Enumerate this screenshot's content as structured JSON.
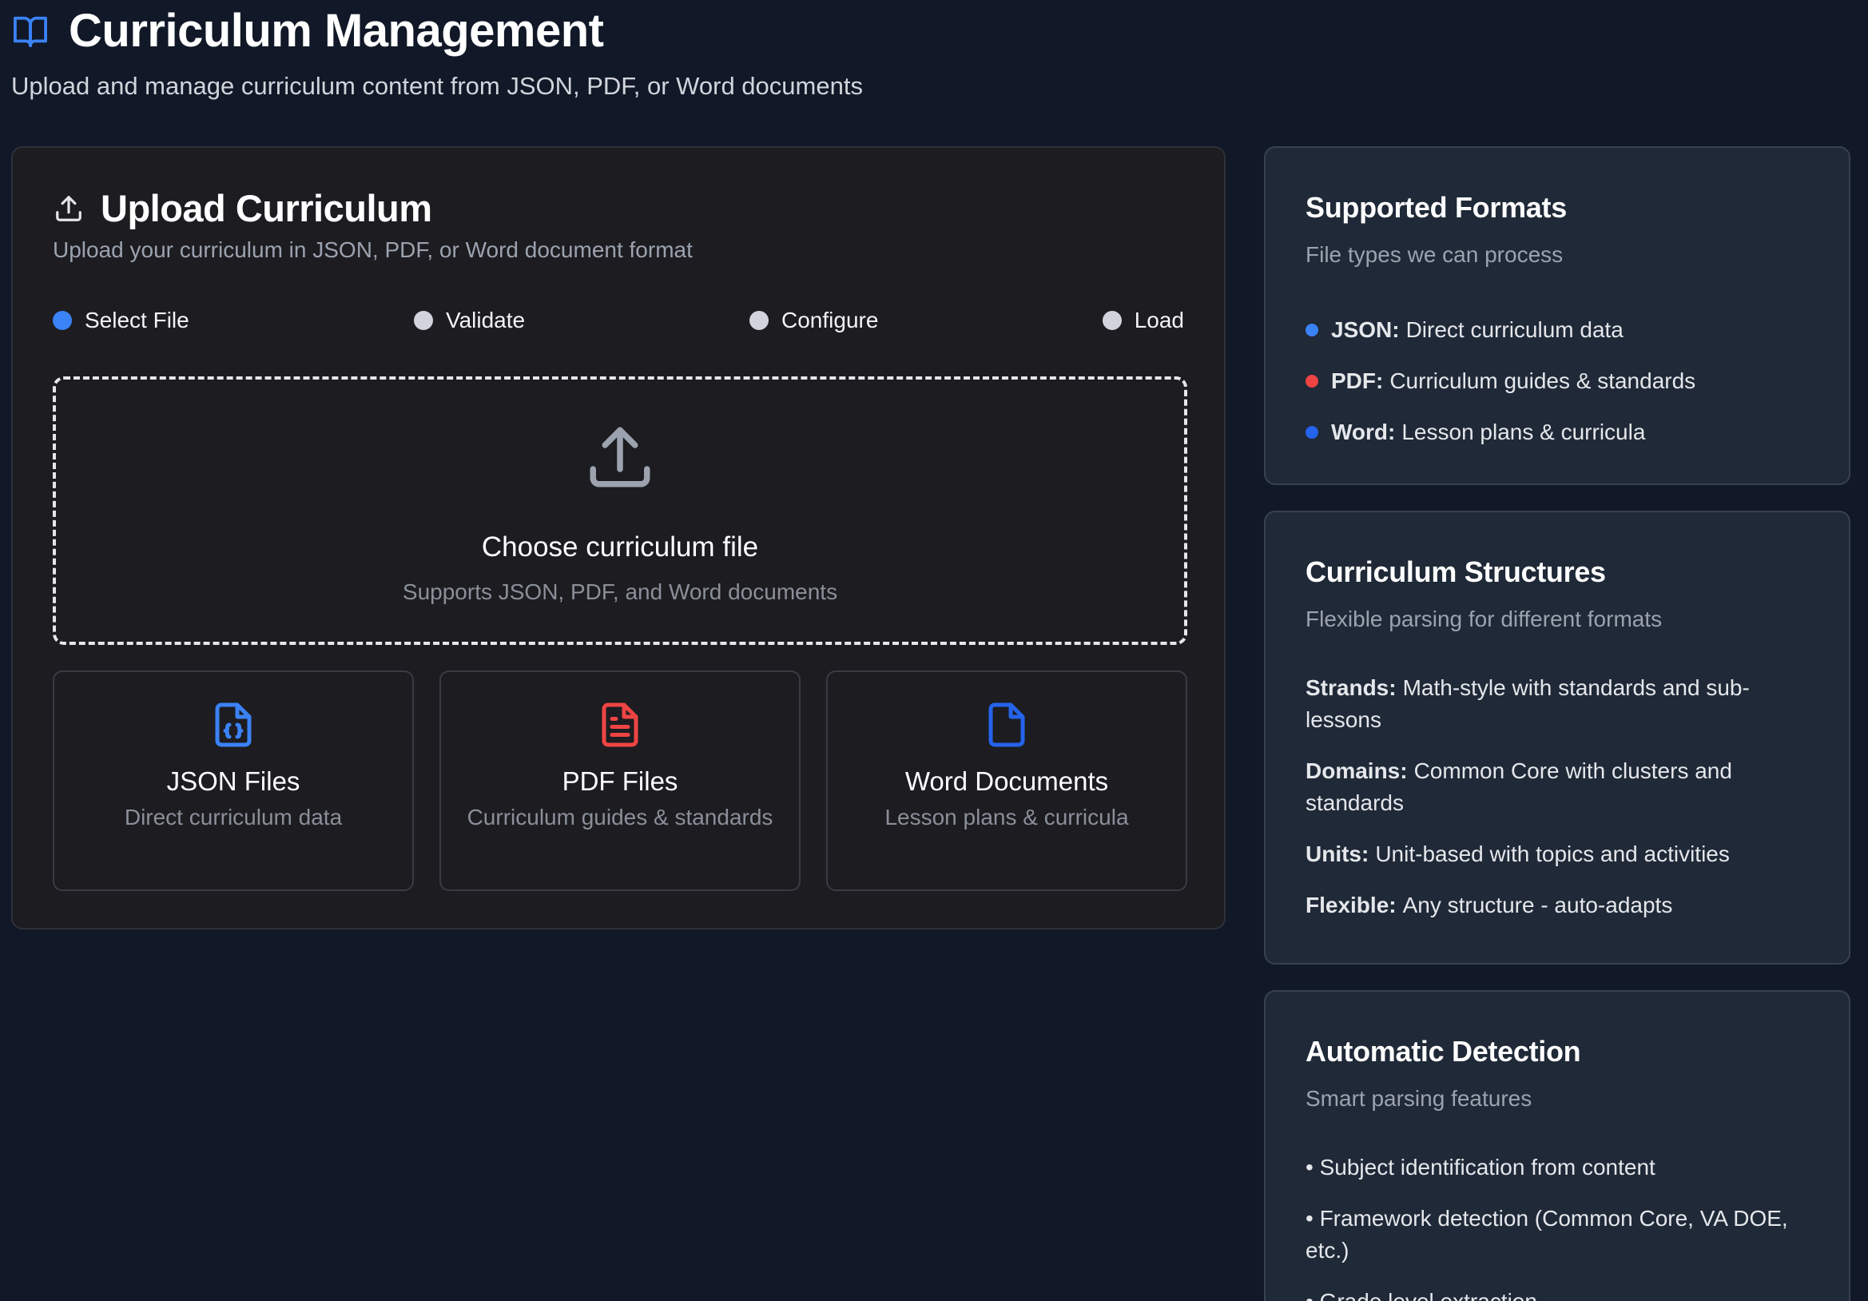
{
  "header": {
    "title": "Curriculum Management",
    "subtitle": "Upload and manage curriculum content from JSON, PDF, or Word documents",
    "icon": "book-open-icon"
  },
  "upload": {
    "title": "Upload Curriculum",
    "description": "Upload your curriculum in JSON, PDF, or Word document format",
    "icon": "upload-icon",
    "steps": [
      {
        "label": "Select File",
        "active": true
      },
      {
        "label": "Validate",
        "active": false
      },
      {
        "label": "Configure",
        "active": false
      },
      {
        "label": "Load",
        "active": false
      }
    ],
    "dropzone": {
      "title": "Choose curriculum file",
      "subtitle": "Supports JSON, PDF, and Word documents",
      "icon": "upload-arrow-icon"
    },
    "file_types": [
      {
        "title": "JSON Files",
        "subtitle": "Direct curriculum data",
        "icon": "file-json-icon",
        "color": "#3b82f6"
      },
      {
        "title": "PDF Files",
        "subtitle": "Curriculum guides & standards",
        "icon": "file-text-icon",
        "color": "#ef4444"
      },
      {
        "title": "Word Documents",
        "subtitle": "Lesson plans & curricula",
        "icon": "file-icon",
        "color": "#2563eb"
      }
    ]
  },
  "supported_formats": {
    "title": "Supported Formats",
    "subtitle": "File types we can process",
    "items": [
      {
        "label": "JSON:",
        "text": "Direct curriculum data",
        "color": "#3b82f6"
      },
      {
        "label": "PDF:",
        "text": "Curriculum guides & standards",
        "color": "#ef4444"
      },
      {
        "label": "Word:",
        "text": "Lesson plans & curricula",
        "color": "#2563eb"
      }
    ]
  },
  "structures": {
    "title": "Curriculum Structures",
    "subtitle": "Flexible parsing for different formats",
    "items": [
      {
        "label": "Strands:",
        "text": "Math-style with standards and sub-lessons"
      },
      {
        "label": "Domains:",
        "text": "Common Core with clusters and standards"
      },
      {
        "label": "Units:",
        "text": "Unit-based with topics and activities"
      },
      {
        "label": "Flexible:",
        "text": "Any structure - auto-adapts"
      }
    ]
  },
  "detection": {
    "title": "Automatic Detection",
    "subtitle": "Smart parsing features",
    "items": [
      "• Subject identification from content",
      "• Framework detection (Common Core, VA DOE, etc.)",
      "• Grade level extraction"
    ]
  }
}
